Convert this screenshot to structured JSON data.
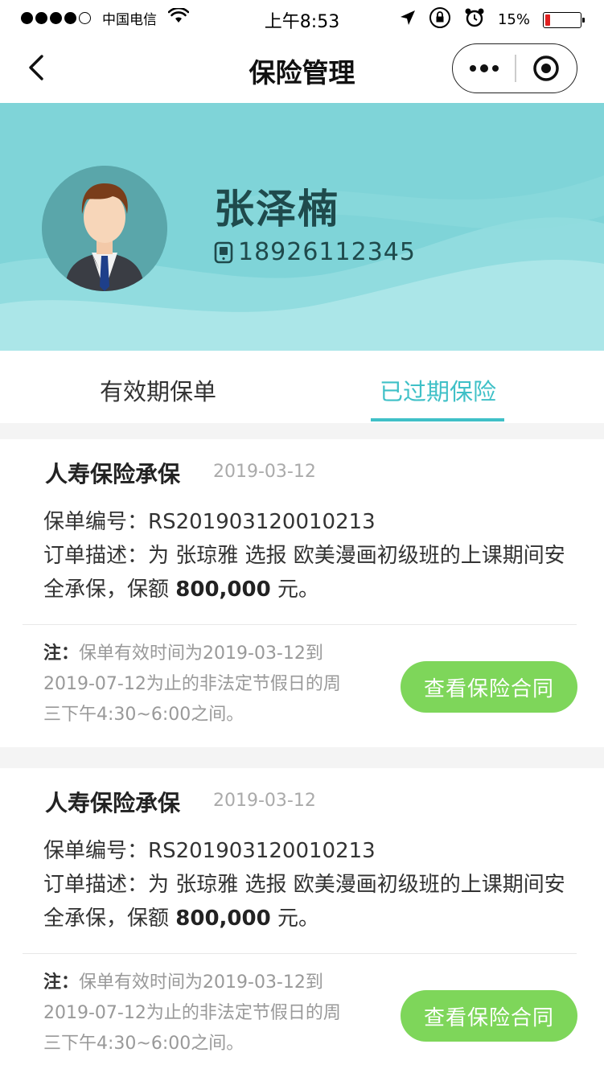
{
  "status_bar": {
    "carrier": "中国电信",
    "time": "上午8:53",
    "battery": "15%",
    "battery_level": 0.15
  },
  "nav": {
    "title": "保险管理"
  },
  "user": {
    "name": "张泽楠",
    "phone": "18926112345"
  },
  "tabs": [
    {
      "label": "有效期保单",
      "active": false
    },
    {
      "label": "已过期保险",
      "active": true
    }
  ],
  "colors": {
    "accent": "#3fc0c7",
    "header_bg": "#7fd4d8",
    "button": "#7ed65a"
  },
  "policies": [
    {
      "title": "人寿保险承保",
      "date": "2019-03-12",
      "policy_no_label": "保单编号：",
      "policy_no": "RS201903120010213",
      "desc_label": "订单描述：",
      "desc_pre": "为 张琼雅 选报 欧美漫画初级班的上课期间安全承保，保额 ",
      "amount": "800,000",
      "desc_post": " 元。",
      "note_label": "注：",
      "note": "保单有效时间为2019-03-12到2019-07-12为止的非法定节假日的周三下午4:30~6:00之间。",
      "button": "查看保险合同"
    },
    {
      "title": "人寿保险承保",
      "date": "2019-03-12",
      "policy_no_label": "保单编号：",
      "policy_no": "RS201903120010213",
      "desc_label": "订单描述：",
      "desc_pre": "为 张琼雅 选报 欧美漫画初级班的上课期间安全承保，保额 ",
      "amount": "800,000",
      "desc_post": " 元。",
      "note_label": "注：",
      "note": "保单有效时间为2019-03-12到2019-07-12为止的非法定节假日的周三下午4:30~6:00之间。",
      "button": "查看保险合同"
    }
  ]
}
